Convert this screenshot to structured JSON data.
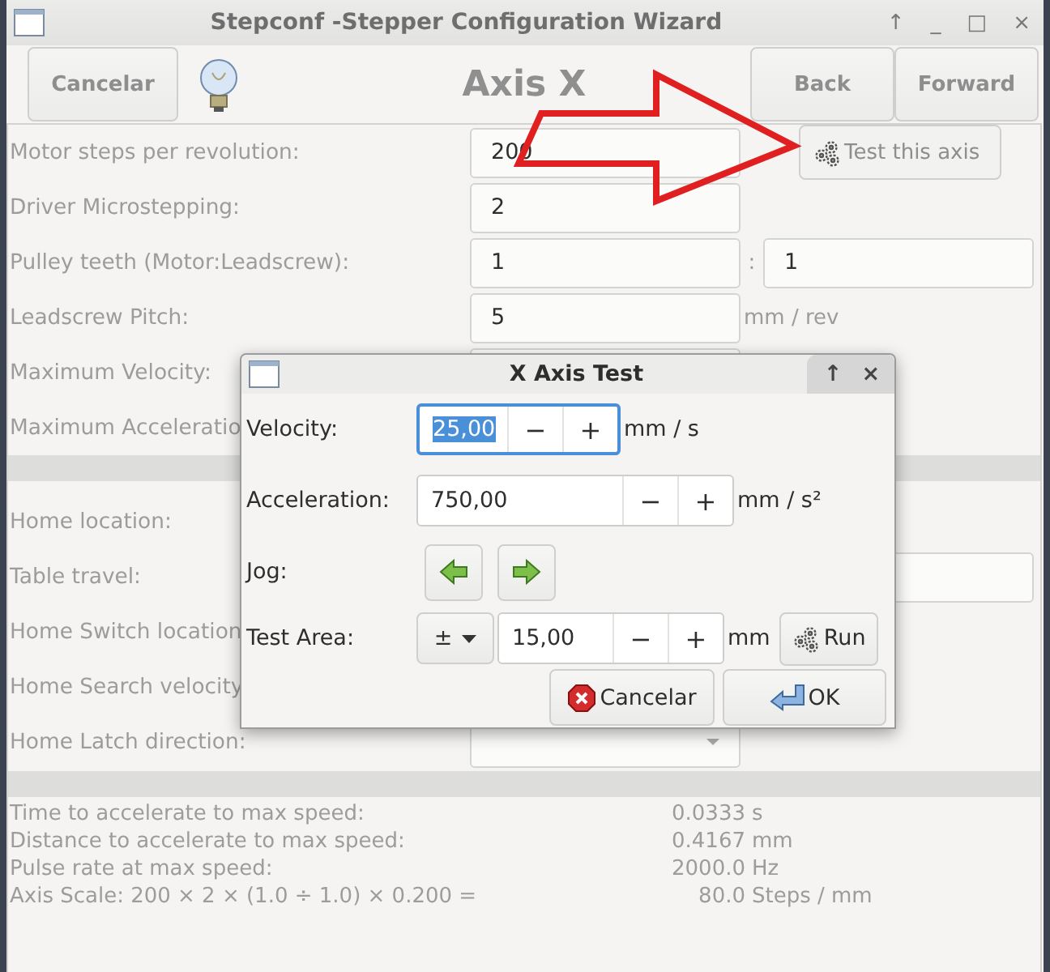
{
  "window": {
    "title": "Stepconf -Stepper Configuration Wizard",
    "controls": [
      "↑",
      "_",
      "□",
      "×"
    ]
  },
  "toolbar": {
    "cancel": "Cancelar",
    "heading": "Axis X",
    "back": "Back",
    "forward": "Forward"
  },
  "motor_rows": [
    {
      "kind": "entry",
      "label": "Motor steps per revolution:",
      "value": "200",
      "button": "Test this axis"
    },
    {
      "kind": "entry",
      "label": "Driver Microstepping:",
      "value": "2"
    },
    {
      "kind": "pair",
      "label": "Pulley teeth (Motor:Leadscrew):",
      "value": "1",
      "separator": ":",
      "value_2": "1"
    },
    {
      "kind": "entry",
      "label": "Leadscrew Pitch:",
      "value": "5",
      "unit": "mm / rev"
    },
    {
      "kind": "entry",
      "label": "Maximum Velocity:"
    },
    {
      "kind": "entry",
      "label": "Maximum Acceleratio"
    }
  ],
  "home_rows": [
    {
      "kind": "label",
      "label": "Home location:"
    },
    {
      "kind": "offset_field",
      "label": "Table travel:"
    },
    {
      "kind": "entry",
      "label": "Home Switch location"
    },
    {
      "kind": "label",
      "label": "Home Search velocity"
    },
    {
      "kind": "combo",
      "label": "Home Latch direction:"
    }
  ],
  "stats": [
    {
      "label": "Time to accelerate to max speed:",
      "value": "0.0333",
      "unit": "s"
    },
    {
      "label": "Distance to accelerate to max speed:",
      "value": "0.4167",
      "unit": "mm"
    },
    {
      "label": "Pulse rate at max speed:",
      "value": "2000.0",
      "unit": "Hz"
    },
    {
      "label": "Axis Scale: 200 × 2 × (1.0 ÷ 1.0) × 0.200 =",
      "value": "80.0",
      "unit": "Steps / mm"
    }
  ],
  "dialog": {
    "title": "X Axis Test",
    "controls": [
      "↑",
      "×"
    ],
    "rows": [
      {
        "kind": "spin",
        "label": "Velocity:",
        "value": "25,00",
        "focused": true,
        "minus": "−",
        "plus": "+",
        "unit": "mm / s"
      },
      {
        "kind": "spin",
        "label": "Acceleration:",
        "value": "750,00",
        "focused": false,
        "minus": "−",
        "plus": "+",
        "unit": "mm / s²"
      },
      {
        "kind": "jog",
        "label": "Jog:"
      },
      {
        "kind": "area",
        "label": "Test Area:",
        "mode": "±",
        "value": "15,00",
        "minus": "−",
        "plus": "+",
        "unit": "mm",
        "button": "Run"
      }
    ],
    "buttons": [
      "Cancelar",
      "OK"
    ]
  }
}
